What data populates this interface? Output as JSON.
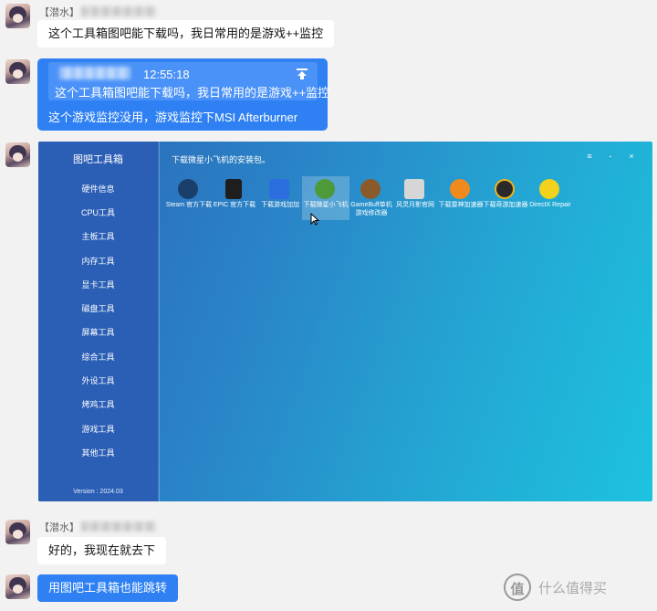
{
  "messages": {
    "m1": {
      "sender_prefix": "【潜水】",
      "text": "这个工具箱图吧能下载吗，我日常用的是游戏++监控"
    },
    "m2": {
      "quote_time": "12:55:18",
      "quote_text": "这个工具箱图吧能下载吗，我日常用的是游戏++监控",
      "reply": "这个游戏监控没用，游戏监控下MSI Afterburner"
    },
    "m4": {
      "sender_prefix": "【潜水】",
      "text": "好的，我现在就去下"
    },
    "m5": {
      "text": "用图吧工具箱也能跳转"
    }
  },
  "tool": {
    "title": "图吧工具箱",
    "header": "下载微星小飞机的安装包。",
    "version": "Version : 2024.03",
    "window_buttons": [
      "≡",
      "-",
      "×"
    ],
    "menu": [
      "硬件信息",
      "CPU工具",
      "主板工具",
      "内存工具",
      "显卡工具",
      "磁盘工具",
      "屏幕工具",
      "综合工具",
      "外设工具",
      "烤鸡工具",
      "游戏工具",
      "其他工具"
    ],
    "apps": [
      {
        "label": "Steam 官方下载",
        "icon": "steam-icon",
        "color": "#1b3f6b"
      },
      {
        "label": "EPIC 官方下载",
        "icon": "epic-icon",
        "color": "#1e1e1e"
      },
      {
        "label": "下载游戏加加",
        "icon": "game-plus-icon",
        "color": "#2c6de0"
      },
      {
        "label": "下载微星小飞机",
        "icon": "afterburner-icon",
        "color": "#4c9a3a"
      },
      {
        "label": "GameBuff单机游戏修改器",
        "icon": "gamebuff-icon",
        "color": "#8a5a2b"
      },
      {
        "label": "风灵月影官网",
        "icon": "flyingmoon-icon",
        "color": "#d6d6d6"
      },
      {
        "label": "下载雷神加速器",
        "icon": "leishen-icon",
        "color": "#f08a1c"
      },
      {
        "label": "下载奇游加速器",
        "icon": "qiyou-icon",
        "color": "#2a2a2a"
      },
      {
        "label": "DirectX Repair",
        "icon": "directx-icon",
        "color": "#f2d21c"
      }
    ]
  },
  "watermark": {
    "logo": "值",
    "text": "什么值得买"
  }
}
